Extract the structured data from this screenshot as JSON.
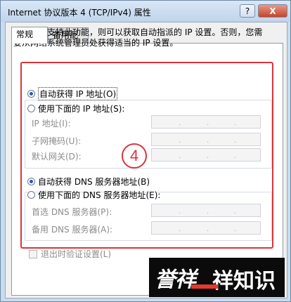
{
  "window": {
    "title": "Internet 协议版本 4 (TCP/IPv4) 属性",
    "help_label": "?",
    "close_label": "X"
  },
  "tabs": [
    {
      "label": "常规"
    },
    {
      "label": "备用配置"
    }
  ],
  "description": "如果网络支持此功能，则可以获取自动指派的 IP 设置。否则，您需要从网络系统管理员处获得适当的 IP 设置。",
  "ip": {
    "auto_label": "自动获得 IP 地址(O)",
    "manual_label": "使用下面的 IP 地址(S):",
    "selected": "auto",
    "fields": [
      {
        "label": "IP 地址(I):",
        "value": ""
      },
      {
        "label": "子网掩码(U):",
        "value": ""
      },
      {
        "label": "默认网关(D):",
        "value": ""
      }
    ]
  },
  "dns": {
    "auto_label": "自动获得 DNS 服务器地址(B)",
    "manual_label": "使用下面的 DNS 服务器地址(E):",
    "selected": "auto",
    "fields": [
      {
        "label": "首选 DNS 服务器(P):",
        "value": ""
      },
      {
        "label": "备用 DNS 服务器(A):",
        "value": ""
      }
    ]
  },
  "annotation_number": "4",
  "validate_label": "退出时验证设置(L)",
  "validate_checked": false,
  "watermark": {
    "left": "誉祥",
    "right": "祥知识"
  },
  "colors": {
    "annotation": "#d7353b",
    "selected_radio": "#2c5b9e"
  }
}
